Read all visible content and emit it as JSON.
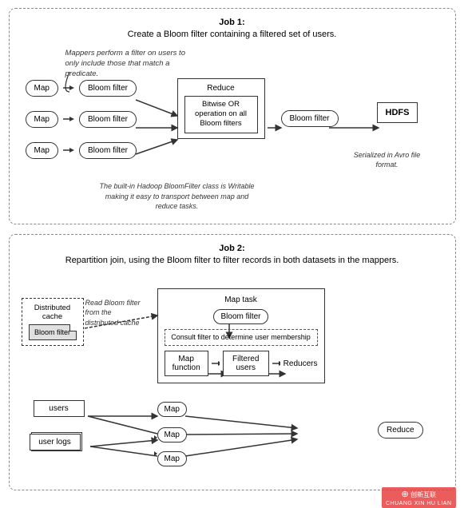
{
  "job1": {
    "title_line1": "Job 1:",
    "title_line2": "Create a Bloom filter containing a filtered set of users.",
    "annotation": "Mappers perform a filter on users to only include those that match a predicate.",
    "map_labels": [
      "Map",
      "Map",
      "Map"
    ],
    "bloom_filter_label": "Bloom filter",
    "reduce_title": "Reduce",
    "reduce_inner": "Bitwise OR operation on all Bloom filters",
    "bloom_out_label": "Bloom filter",
    "hdfs_label": "HDFS",
    "bottom_note": "The built-in Hadoop BloomFilter class is Writable making it easy to transport between map and reduce tasks.",
    "serialized_note": "Serialized in Avro file format."
  },
  "job2": {
    "title_line1": "Job 2:",
    "title_line2": "Repartition join, using the Bloom filter to filter records in both datasets in the mappers.",
    "distributed_cache_label": "Distributed cache",
    "bloom_filter_file_label": "Bloom filter",
    "read_bloom_note": "Read Bloom filter from the distributed cache",
    "map_task_title": "Map task",
    "bloom_filter_in_map": "Bloom filter",
    "consult_text": "Consult filter to determine user membership",
    "map_function_label": "Map function",
    "filtered_users_label": "Filtered users",
    "reducers_label": "Reducers",
    "datasets": [
      "users",
      "user logs"
    ],
    "map_labels": [
      "Map",
      "Map",
      "Map"
    ],
    "reduce_label": "Reduce"
  },
  "watermark": {
    "line1": "创新互联",
    "url": "CHUANG XIN HU LIAN"
  }
}
